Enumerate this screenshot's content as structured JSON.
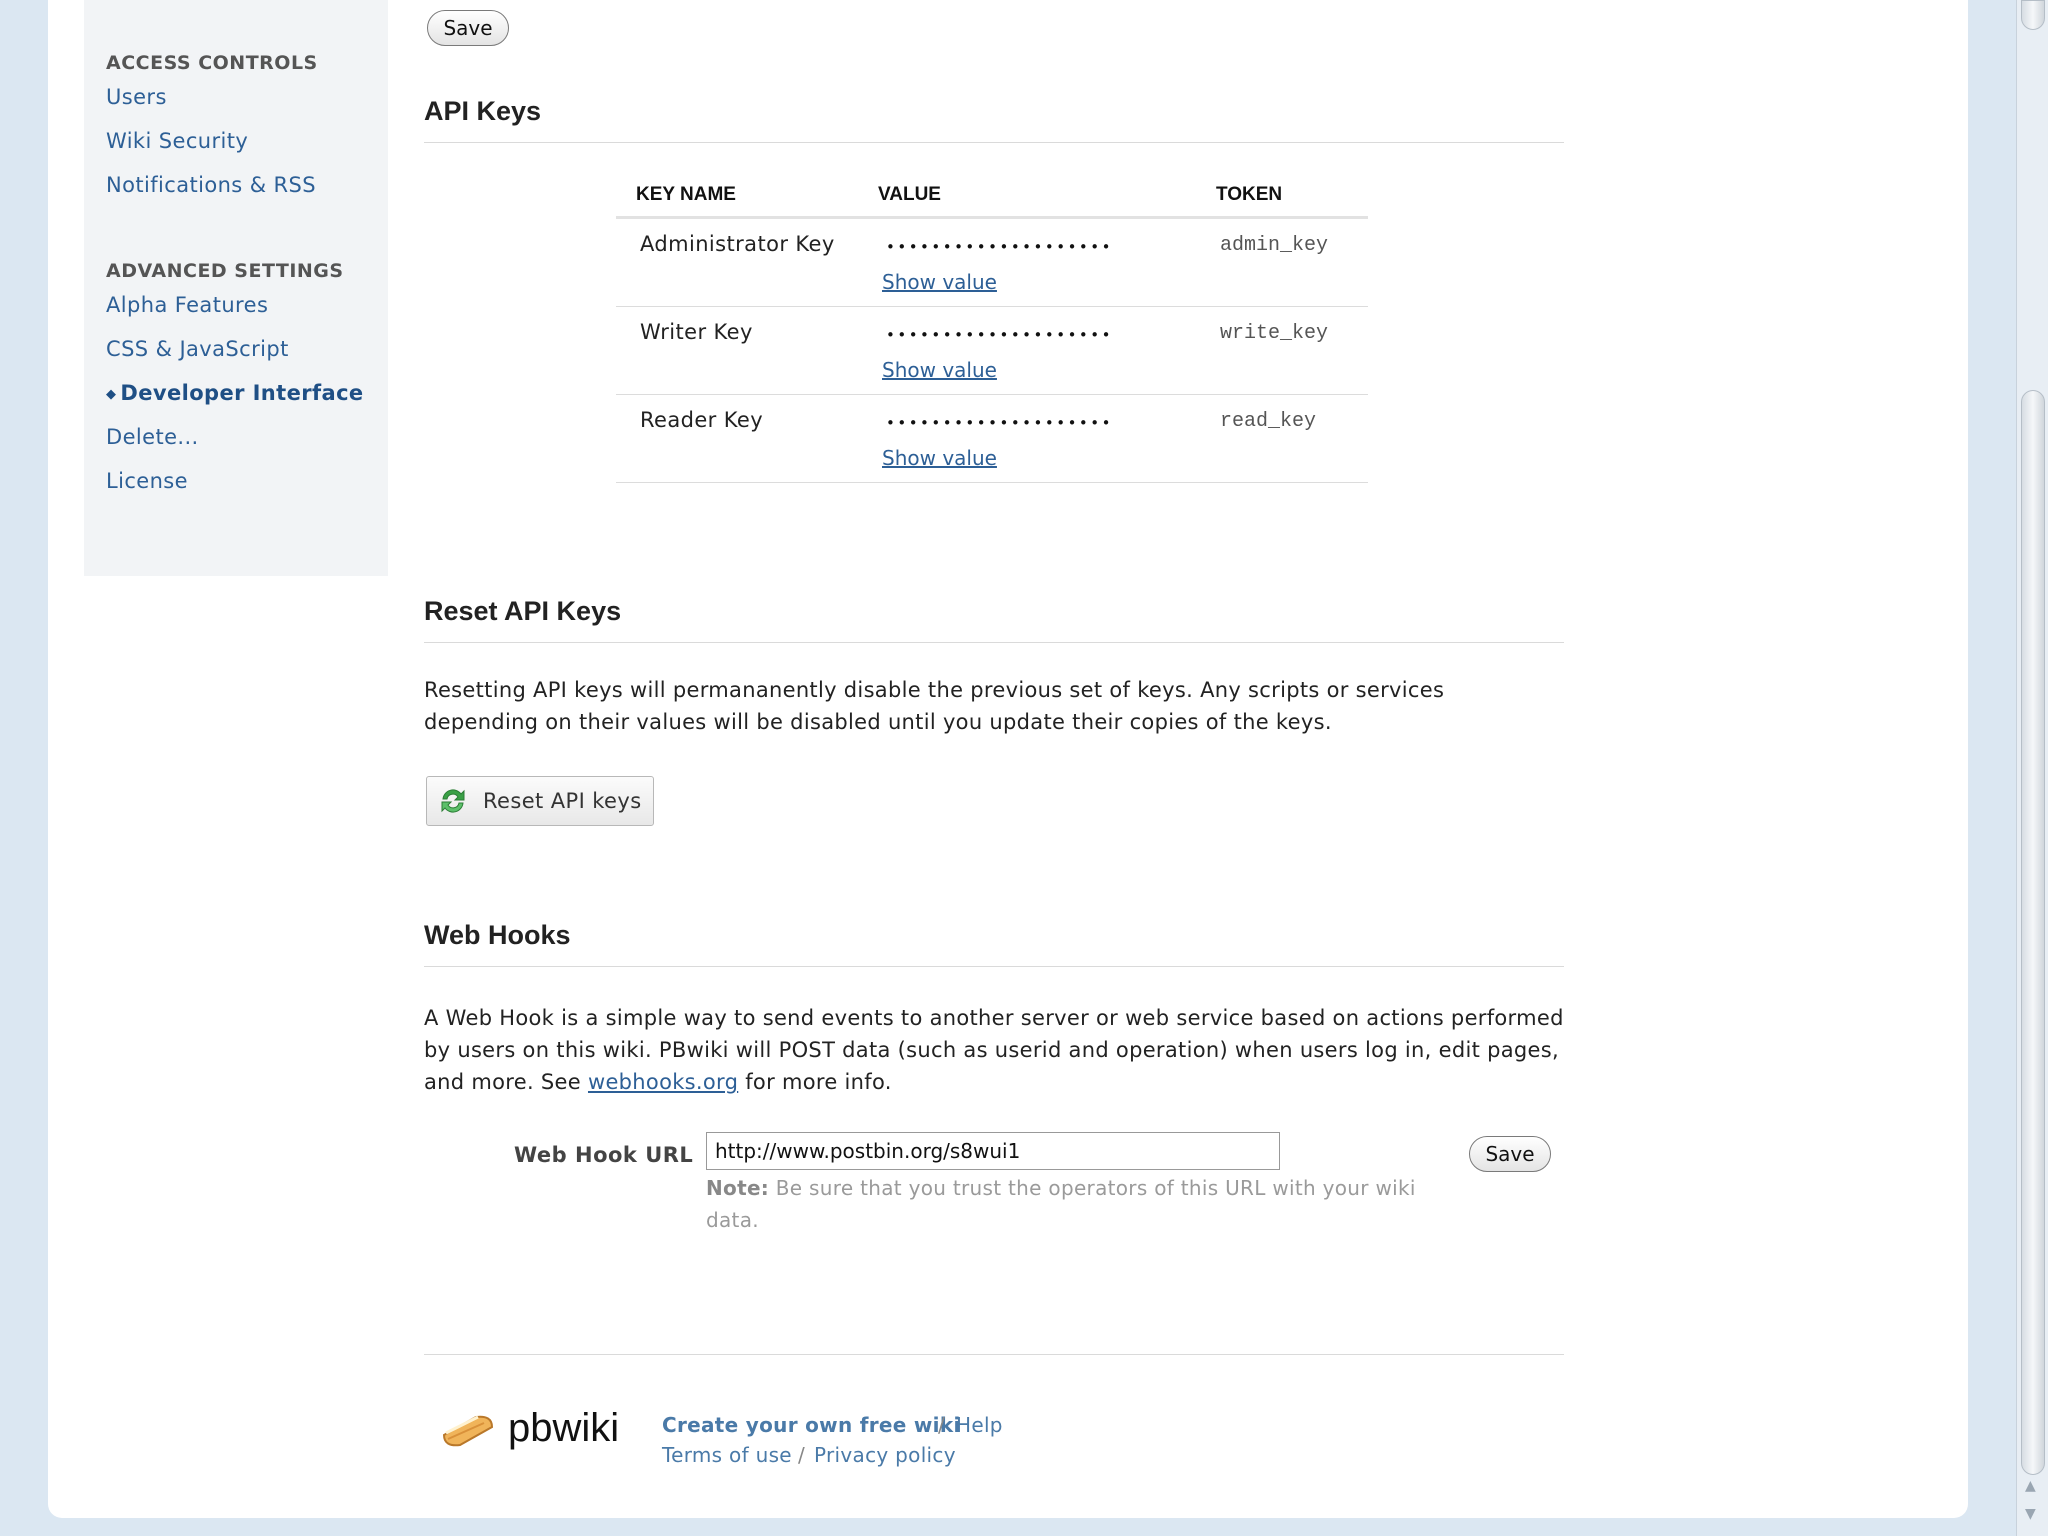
{
  "sidebar": {
    "access_heading": "ACCESS CONTROLS",
    "access_items": [
      "Users",
      "Wiki Security",
      "Notifications & RSS"
    ],
    "advanced_heading": "ADVANCED SETTINGS",
    "advanced_items": [
      "Alpha Features",
      "CSS & JavaScript",
      "Developer Interface",
      "Delete...",
      "License"
    ],
    "active_item": "Developer Interface"
  },
  "top_save_label": "Save",
  "api_keys": {
    "title": "API Keys",
    "columns": [
      "KEY NAME",
      "VALUE",
      "TOKEN"
    ],
    "rows": [
      {
        "name": "Administrator Key",
        "value_masked": "••••••••••••••••••••",
        "show_label": "Show value",
        "token": "admin_key"
      },
      {
        "name": "Writer Key",
        "value_masked": "••••••••••••••••••••",
        "show_label": "Show value",
        "token": "write_key"
      },
      {
        "name": "Reader Key",
        "value_masked": "••••••••••••••••••••",
        "show_label": "Show value",
        "token": "read_key"
      }
    ]
  },
  "reset": {
    "title": "Reset API Keys",
    "description": "Resetting API keys will permananently disable the previous set of keys. Any scripts or services depending on their values will be disabled until you update their copies of the keys.",
    "button_label": "Reset API keys",
    "button_icon": "refresh-arrows-icon"
  },
  "webhooks": {
    "title": "Web Hooks",
    "description_before": "A Web Hook is a simple way to send events to another server or web service based on actions performed by users on this wiki. PBwiki will POST data (such as userid and operation) when users log in, edit pages, and more. See ",
    "link_text": "webhooks.org",
    "description_after": " for more info.",
    "url_label": "Web Hook URL",
    "url_value": "http://www.postbin.org/s8wui1",
    "note_label": "Note:",
    "note_text": " Be sure that you trust the operators of this URL with your wiki data.",
    "save_label": "Save"
  },
  "footer": {
    "logo_text": "pbwiki",
    "logo_icon": "sandwich-icon",
    "links": [
      "Create your own free wiki",
      "Help",
      "Terms of use",
      "Privacy policy"
    ],
    "separator": "/"
  },
  "colors": {
    "link": "#2d5f96",
    "page_background": "#dbe7f2",
    "sidebar_background": "#f2f4f6"
  }
}
